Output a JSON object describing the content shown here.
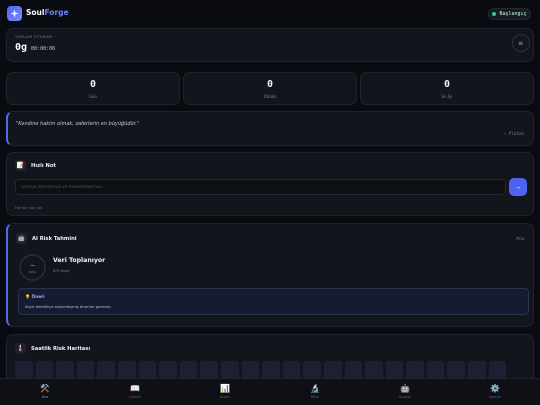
{
  "header": {
    "brand_primary": "Soul",
    "brand_accent": "Forge",
    "logo_icon": "sparkle-icon",
    "start_label": "Başlangıç"
  },
  "session": {
    "label": "TOPLAM OTURUM",
    "big_value": "0g",
    "time": "00:00:06",
    "ring_label": "0h"
  },
  "stats": [
    {
      "value": "0",
      "label": "Gün"
    },
    {
      "value": "0",
      "label": "Odaklı"
    },
    {
      "value": "0",
      "label": "En İyi"
    }
  ],
  "quote": {
    "text": "\"Kendine hakim olmak, zaferlerin en büyüğüdür.\"",
    "author": "— Platon"
  },
  "quick_note": {
    "icon": "memo-icon",
    "title": "Hızlı Not",
    "placeholder": "Günlük dersleriniz ve hissettiklerinizi...",
    "send_icon": "arrow-right-icon",
    "empty_text": "Henüz not yok"
  },
  "risk": {
    "icon": "robot-icon",
    "title": "AI Risk Tahmini",
    "link": "Ana",
    "gauge_value": "—",
    "gauge_label": "RİSK",
    "status": "Veri Toplanıyor",
    "sub": "0/3 kayıt",
    "suggestion_title": "💡 Öneri",
    "suggestion_body": "Kayıt ekledikçe kişiselleşmiş öneriler gelecek."
  },
  "heatmap": {
    "icon": "thermometer-icon",
    "title": "Saatlik Risk Haritası",
    "cell_count": 24
  },
  "nav": [
    {
      "icon": "tools-icon",
      "glyph": "⚒️",
      "label": "Ana",
      "active": true
    },
    {
      "icon": "book-icon",
      "glyph": "📖",
      "label": "Günlük",
      "active": false
    },
    {
      "icon": "chart-icon",
      "glyph": "📊",
      "label": "Analiz",
      "active": false
    },
    {
      "icon": "microscope-icon",
      "glyph": "🔬",
      "label": "Bilim",
      "active": false
    },
    {
      "icon": "robot-icon",
      "glyph": "🤖",
      "label": "Asistan",
      "active": false
    },
    {
      "icon": "gear-icon",
      "glyph": "⚙️",
      "label": "Ayarlar",
      "active": false
    }
  ],
  "colors": {
    "accent": "#4f63f2",
    "background": "#0a0b10",
    "card": "#13151c",
    "live_dot": "#2fd07a"
  }
}
